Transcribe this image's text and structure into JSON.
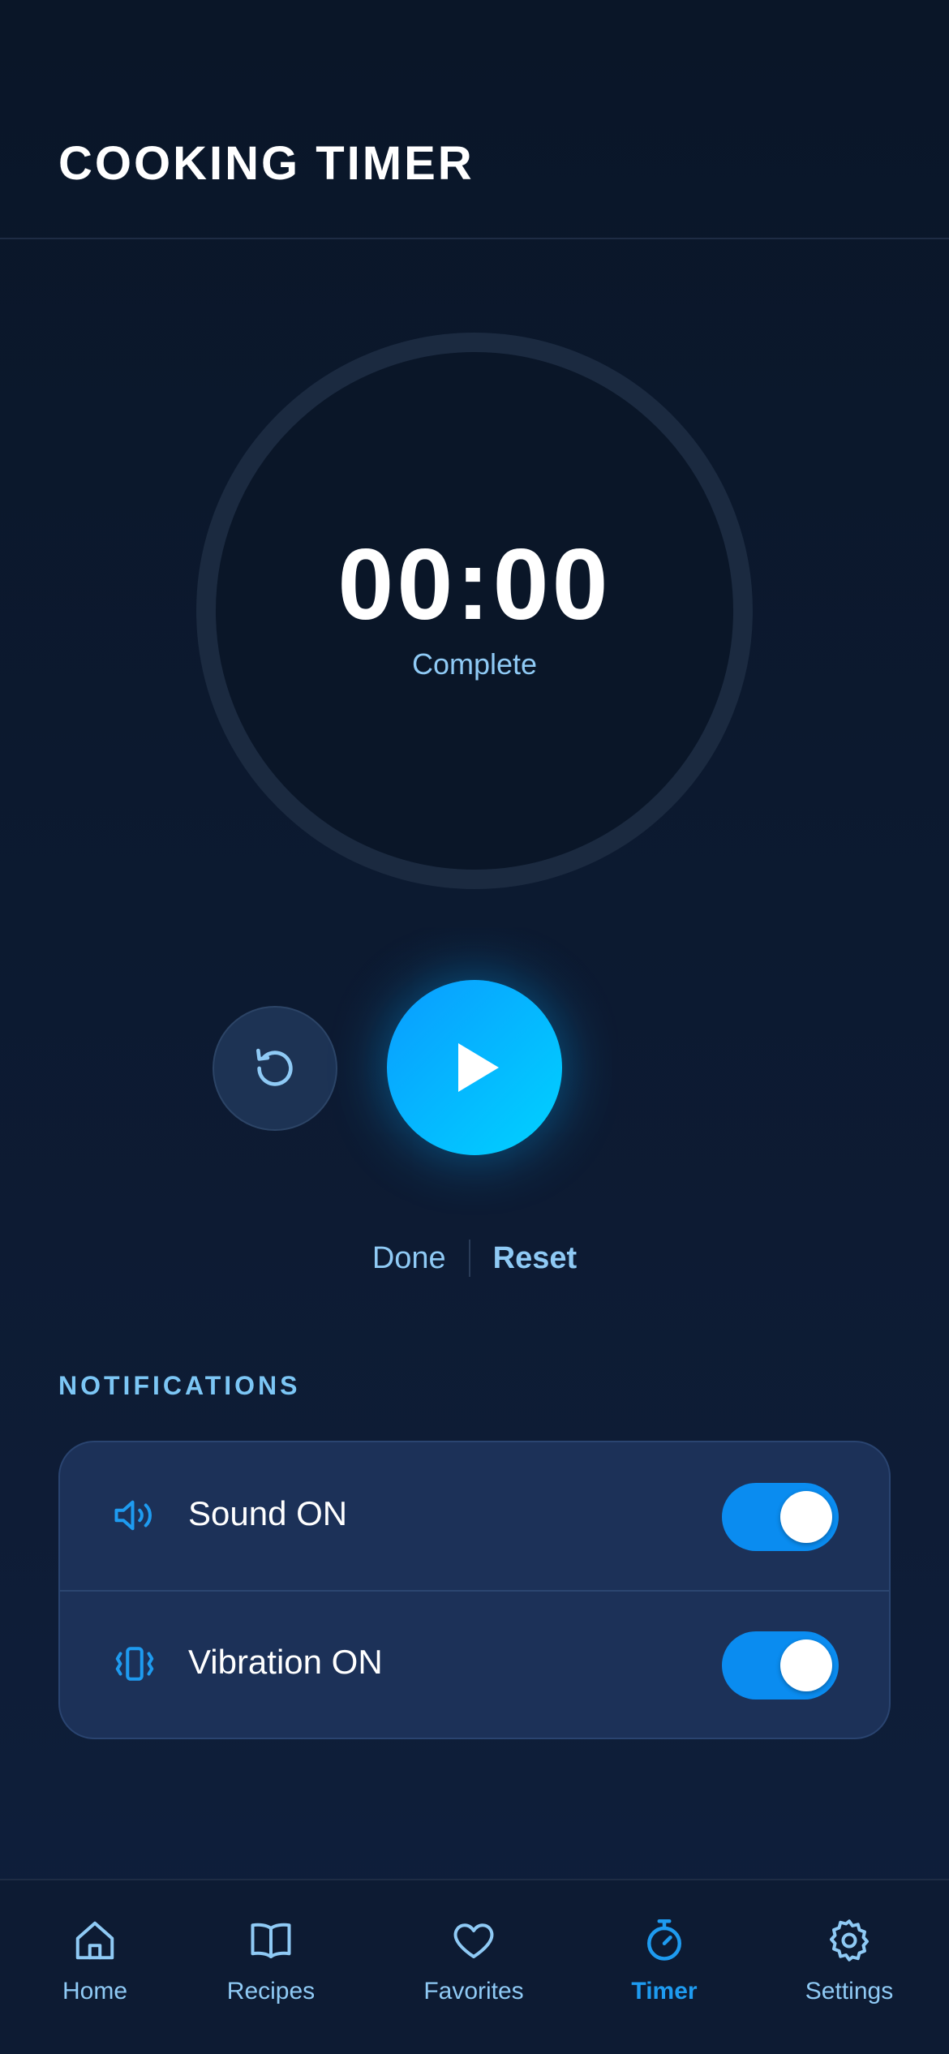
{
  "header": {
    "title": "COOKING TIMER"
  },
  "timer": {
    "value": "00:00",
    "status": "Complete",
    "reset_icon": "restart-icon",
    "play_icon": "play-icon"
  },
  "actions": {
    "done_label": "Done",
    "reset_label": "Reset"
  },
  "notifications": {
    "section_label": "NOTIFICATIONS",
    "items": [
      {
        "icon": "speaker-icon",
        "label": "Sound ON",
        "enabled": true
      },
      {
        "icon": "vibration-icon",
        "label": "Vibration ON",
        "enabled": true
      }
    ]
  },
  "tabbar": {
    "items": [
      {
        "icon": "home-icon",
        "label": "Home",
        "active": false
      },
      {
        "icon": "book-icon",
        "label": "Recipes",
        "active": false
      },
      {
        "icon": "heart-icon",
        "label": "Favorites",
        "active": false
      },
      {
        "icon": "stopwatch-icon",
        "label": "Timer",
        "active": true
      },
      {
        "icon": "gear-icon",
        "label": "Settings",
        "active": false
      }
    ]
  },
  "colors": {
    "background": "#0a1628",
    "accent": "#0a9cff",
    "accent_light": "#8fcaf5",
    "card": "#1c3158",
    "active_tab": "#1e9bf0"
  }
}
